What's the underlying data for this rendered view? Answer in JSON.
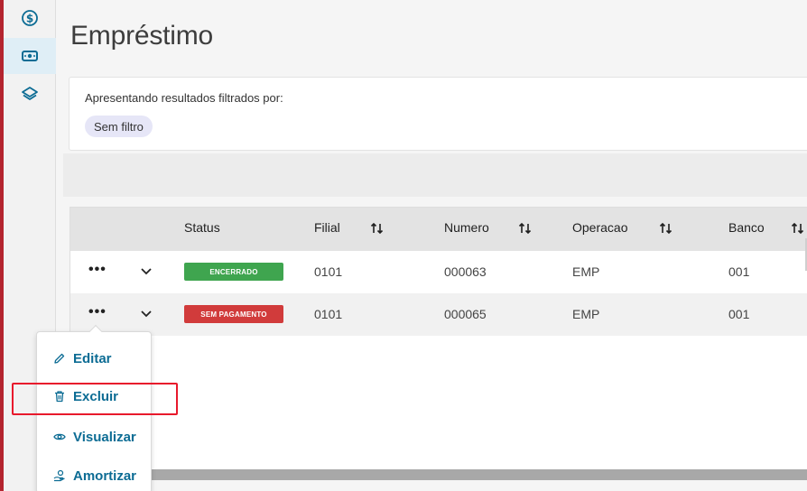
{
  "page": {
    "title": "Empréstimo"
  },
  "sidebar": {
    "items": [
      {
        "icon": "dollar-circle-icon"
      },
      {
        "icon": "money-bill-icon",
        "active": true
      },
      {
        "icon": "layers-icon"
      }
    ]
  },
  "filter": {
    "label": "Apresentando resultados filtrados por:",
    "chip": "Sem filtro"
  },
  "table": {
    "columns": [
      "Status",
      "Filial",
      "Numero",
      "Operacao",
      "Banco"
    ],
    "rows": [
      {
        "status": "ENCERRADO",
        "status_color": "#3fa54f",
        "filial": "0101",
        "numero": "000063",
        "operacao": "EMP",
        "banco": "001"
      },
      {
        "status": "SEM PAGAMENTO",
        "status_color": "#d13b3b",
        "filial": "0101",
        "numero": "000065",
        "operacao": "EMP",
        "banco": "001"
      }
    ]
  },
  "menu": {
    "items": [
      {
        "label": "Editar",
        "icon": "pencil-icon"
      },
      {
        "label": "Excluir",
        "icon": "trash-icon"
      },
      {
        "label": "Visualizar",
        "icon": "eye-icon"
      },
      {
        "label": "Amortizar",
        "icon": "hand-coin-icon"
      }
    ]
  },
  "colors": {
    "accent": "#0c6c94",
    "highlight": "#e8192c"
  }
}
